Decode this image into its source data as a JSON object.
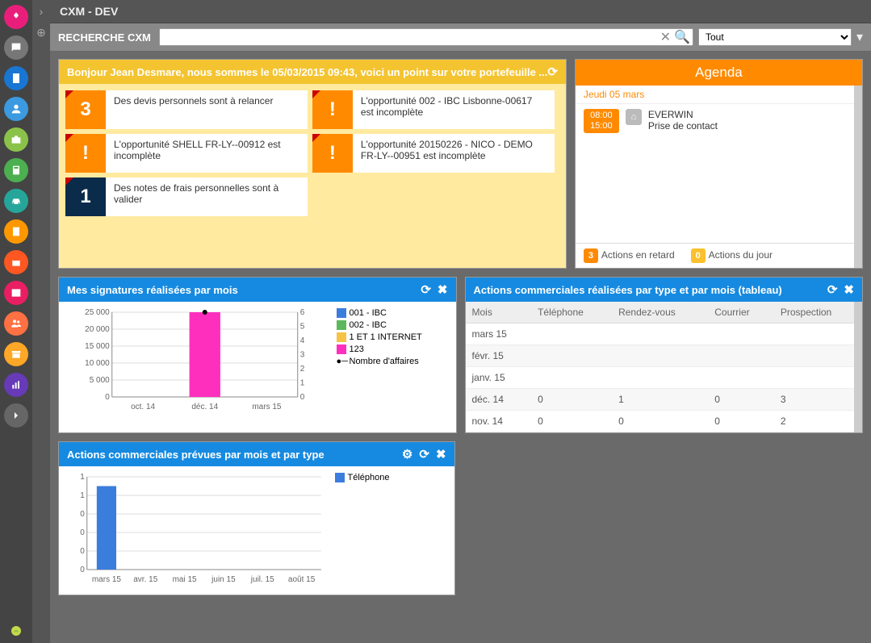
{
  "title": "CXM - DEV",
  "search": {
    "label": "RECHERCHE CXM",
    "placeholder": "",
    "filter_selected": "Tout"
  },
  "welcome": {
    "title": "Bonjour Jean Desmare, nous sommes le 05/03/2015 09:43, voici un point sur votre portefeuille ...",
    "alerts": [
      {
        "badge": "3",
        "badge_color": "orange",
        "text": "Des devis personnels sont à relancer"
      },
      {
        "badge": "!",
        "badge_color": "orange",
        "text": "L'opportunité 002 - IBC Lisbonne-00617 est incomplète"
      },
      {
        "badge": "!",
        "badge_color": "orange",
        "text": "L'opportunité SHELL FR-LY--00912 est incomplète"
      },
      {
        "badge": "!",
        "badge_color": "orange",
        "text": "L'opportunité 20150226 - NICO - DEMO FR-LY--00951 est incomplète"
      },
      {
        "badge": "1",
        "badge_color": "darkblue",
        "text": "Des notes de frais personnelles sont à valider"
      }
    ]
  },
  "agenda": {
    "title": "Agenda",
    "date": "Jeudi 05 mars",
    "items": [
      {
        "start": "08:00",
        "end": "15:00",
        "company": "EVERWIN",
        "subject": "Prise de contact"
      }
    ],
    "footer": {
      "late_count": "3",
      "late_label": "Actions en retard",
      "today_count": "0",
      "today_label": "Actions du jour"
    }
  },
  "sign_panel": {
    "title": "Mes signatures réalisées par mois"
  },
  "actions_table_panel": {
    "title": "Actions commerciales réalisées par type et par mois (tableau)",
    "headers": [
      "Mois",
      "Téléphone",
      "Rendez-vous",
      "Courrier",
      "Prospection"
    ],
    "rows": [
      [
        "mars 15",
        "",
        "",
        "",
        ""
      ],
      [
        "févr. 15",
        "",
        "",
        "",
        ""
      ],
      [
        "janv. 15",
        "",
        "",
        "",
        ""
      ],
      [
        "déc. 14",
        "0",
        "1",
        "0",
        "3"
      ],
      [
        "nov. 14",
        "0",
        "0",
        "0",
        "2"
      ]
    ]
  },
  "planned_panel": {
    "title": "Actions commerciales prévues par mois et par type"
  },
  "chart_data": [
    {
      "id": "signatures",
      "type": "bar",
      "title": "Mes signatures réalisées par mois",
      "categories": [
        "oct. 14",
        "déc. 14",
        "mars 15"
      ],
      "ylabel_left": "",
      "ylim_left": [
        0,
        25000
      ],
      "yticks_left": [
        0,
        5000,
        10000,
        15000,
        20000,
        25000
      ],
      "ylabel_right": "",
      "ylim_right": [
        0,
        6
      ],
      "yticks_right": [
        0,
        1,
        2,
        3,
        4,
        5,
        6
      ],
      "series": [
        {
          "name": "001 - IBC",
          "color": "#3b7ddd",
          "values": [
            0,
            0,
            0
          ]
        },
        {
          "name": "002 - IBC",
          "color": "#5cb85c",
          "values": [
            0,
            0,
            0
          ]
        },
        {
          "name": "1 ET 1 INTERNET",
          "color": "#f6c344",
          "values": [
            0,
            0,
            0
          ]
        },
        {
          "name": "123",
          "color": "#ff2fbe",
          "values": [
            0,
            25000,
            0
          ]
        }
      ],
      "line_series": {
        "name": "Nombre d'affaires",
        "color": "#000",
        "values": [
          null,
          6,
          null
        ]
      }
    },
    {
      "id": "planned",
      "type": "bar",
      "title": "Actions commerciales prévues par mois et par type",
      "categories": [
        "mars 15",
        "avr. 15",
        "mai 15",
        "juin 15",
        "juil. 15",
        "août 15"
      ],
      "ylim": [
        0,
        1
      ],
      "yticks": [
        0,
        0,
        0,
        0,
        1,
        1
      ],
      "series": [
        {
          "name": "Téléphone",
          "color": "#3b7ddd",
          "values": [
            1,
            0,
            0,
            0,
            0,
            0
          ]
        }
      ]
    }
  ]
}
